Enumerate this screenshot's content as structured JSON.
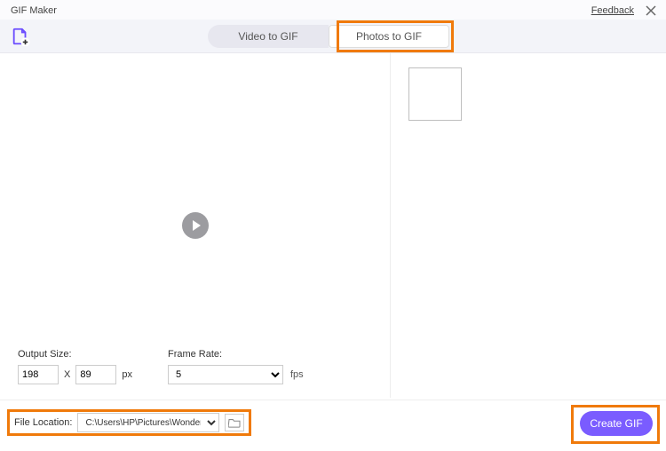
{
  "window": {
    "title": "GIF Maker",
    "feedback": "Feedback"
  },
  "tabs": {
    "video": "Video to GIF",
    "photos": "Photos to GIF"
  },
  "settings": {
    "outputSizeLabel": "Output Size:",
    "width": "198",
    "height": "89",
    "unit": "px",
    "frameRateLabel": "Frame Rate:",
    "frameRate": "5",
    "fpsUnit": "fps"
  },
  "footer": {
    "fileLocationLabel": "File Location:",
    "fileLocation": "C:\\Users\\HP\\Pictures\\Wondersh",
    "createBtn": "Create GIF"
  }
}
